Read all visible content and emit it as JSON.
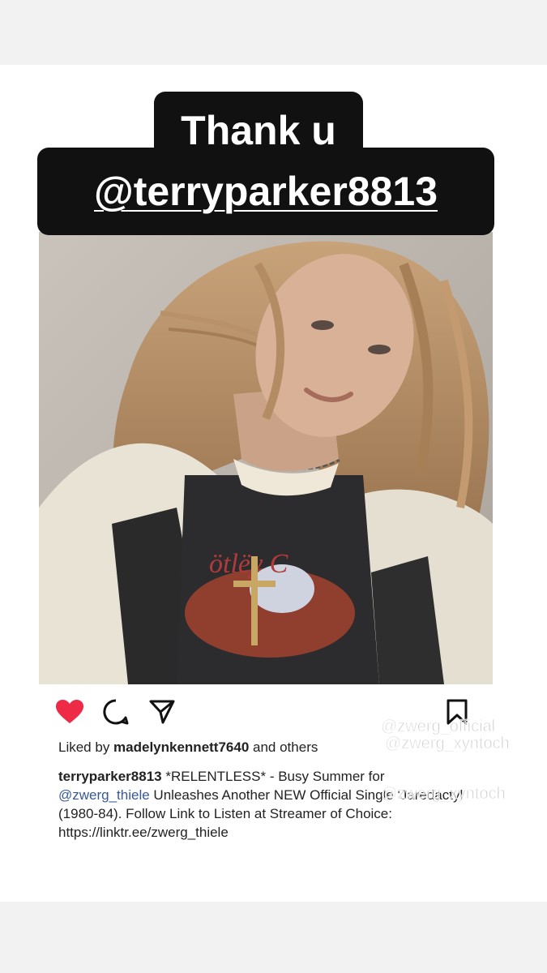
{
  "sticker": {
    "line1": "Thank u",
    "line2": "@terryparker8813"
  },
  "post": {
    "liked_by_prefix": "Liked by ",
    "liked_by_user": "madelynkennett7640",
    "liked_by_suffix": " and others",
    "caption_user": "terryparker8813",
    "caption_part1": " *RELENTLESS* - Busy Summer for ",
    "caption_mention": "@zwerg_thiele",
    "caption_part2": " Unleashes Another NEW Official Single 'Jaredactyl (1980-84). Follow Link to Listen at Streamer of Choice:",
    "caption_link": "https://linktr.ee/zwerg_thiele"
  },
  "icons": {
    "like": "heart-icon",
    "comment": "comment-icon",
    "share": "send-icon",
    "save": "bookmark-icon"
  },
  "watermarks": {
    "w1": "@zwerg_official",
    "w2": "@zwerg_xyntoch",
    "w3": "@zwerg_xyntoch"
  },
  "colors": {
    "heart": "#ed2b47",
    "mention": "#385898"
  }
}
